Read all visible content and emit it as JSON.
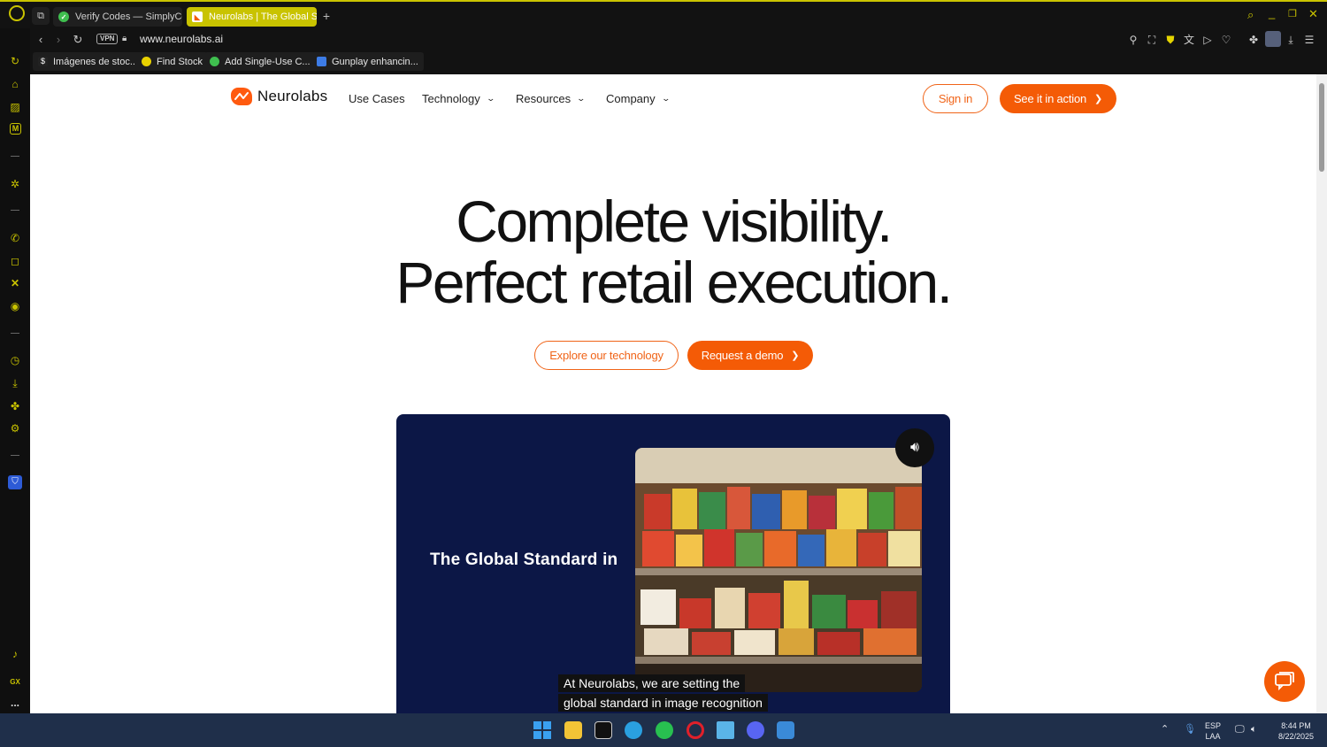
{
  "browser": {
    "tabs": [
      {
        "title": "Verify Codes — SimplyCo",
        "active": false
      },
      {
        "title": "Neurolabs | The Global St",
        "active": true
      }
    ],
    "new_tab": "+",
    "vpn_label": "VPN",
    "url": "www.neurolabs.ai",
    "bookmarks": [
      {
        "label": "Imágenes de stoc..."
      },
      {
        "label": "Find Stock"
      },
      {
        "label": "Add Single-Use C..."
      },
      {
        "label": "Gunplay enhancin..."
      }
    ],
    "sidebar_gx_label": "GX",
    "sidebar_more": "..."
  },
  "site": {
    "brand": "Neurolabs",
    "nav": {
      "use_cases": "Use Cases",
      "technology": "Technology",
      "resources": "Resources",
      "company": "Company"
    },
    "sign_in": "Sign in",
    "cta_header": "See it in action",
    "headline_line1": "Complete visibility.",
    "headline_line2": "Perfect retail execution.",
    "explore_btn": "Explore our technology",
    "demo_btn": "Request a demo",
    "video": {
      "overlay_text": "The Global Standard in",
      "caption_line1": "At Neurolabs, we are setting the",
      "caption_line2": "global standard in image recognition"
    }
  },
  "taskbar": {
    "lang_top": "ESP",
    "lang_bottom": "LAA",
    "time": "8:44 PM",
    "date": "8/22/2025"
  },
  "colors": {
    "brand_orange": "#f45b06",
    "opera_accent": "#c9c300",
    "video_bg": "#0c1746"
  }
}
